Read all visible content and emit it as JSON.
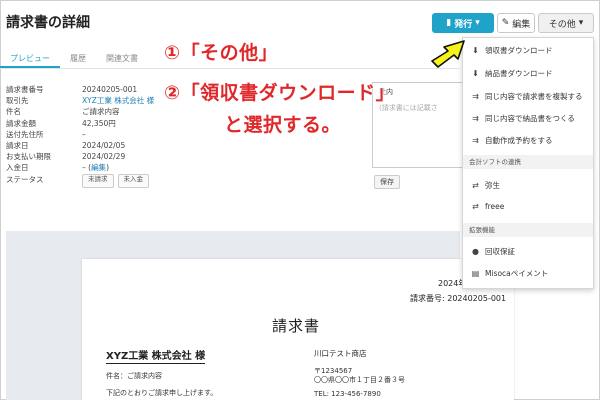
{
  "header": {
    "title": "請求書の詳細",
    "issue_label": "発行",
    "edit_label": "編集",
    "other_label": "その他"
  },
  "tabs": [
    {
      "label": "プレビュー",
      "active": true
    },
    {
      "label": "履歴",
      "active": false
    },
    {
      "label": "関連文書",
      "active": false
    }
  ],
  "info": {
    "rows": [
      {
        "label": "請求書番号",
        "value": "20240205-001"
      },
      {
        "label": "取引先",
        "value": "XYZ工業 株式会社 様"
      },
      {
        "label": "件名",
        "value": "ご請求内容"
      },
      {
        "label": "請求金額",
        "value": "42,350円"
      },
      {
        "label": "送付先住所",
        "value": "–"
      },
      {
        "label": "請求日",
        "value": "2024/02/05"
      },
      {
        "label": "お支払い期限",
        "value": "2024/02/29"
      },
      {
        "label": "入金日",
        "value": "– (",
        "link": "編集",
        "suffix": ")"
      },
      {
        "label": "ステータス",
        "value": ""
      }
    ],
    "status_buttons": [
      "未請求",
      "未入金"
    ]
  },
  "memo": {
    "label": "社内",
    "placeholder": "(請求書には記載さ",
    "save_label": "保存"
  },
  "document": {
    "date": "2024年0",
    "invoice_no": "請求番号: 20240205-001",
    "title": "請求書",
    "client": "XYZ工業 株式会社 様",
    "subject": "件名：ご請求内容",
    "note": "下記のとおりご請求申し上げます。",
    "company": "川口テスト商店",
    "postal": "〒1234567",
    "address": "〇〇県〇〇市１丁目２番３号",
    "tel": "TEL: 123-456-7890"
  },
  "dropdown": {
    "items": [
      {
        "label": "領収書ダウンロード",
        "icon": "download-icon",
        "glyph": "⬇"
      },
      {
        "label": "納品書ダウンロード",
        "icon": "download-icon",
        "glyph": "⬇"
      },
      {
        "label": "同じ内容で請求書を複製する",
        "icon": "duplicate-icon",
        "glyph": "⇉"
      },
      {
        "label": "同じ内容で納品書をつくる",
        "icon": "duplicate-icon",
        "glyph": "⇉"
      },
      {
        "label": "自動作成予約をする",
        "icon": "schedule-icon",
        "glyph": "⇉"
      }
    ],
    "section_accounting": "会計ソフトの連携",
    "accounting_items": [
      {
        "label": "弥生",
        "icon": "yayoi-icon",
        "glyph": "⇄"
      },
      {
        "label": "freee",
        "icon": "freee-icon",
        "glyph": "⇄"
      }
    ],
    "section_extension": "拡張機能",
    "extension_items": [
      {
        "label": "回収保証",
        "icon": "shield-icon",
        "glyph": "●"
      },
      {
        "label": "Misocaペイメント",
        "icon": "payment-icon",
        "glyph": "▤"
      }
    ]
  },
  "annotations": {
    "line1": "①「その他」",
    "line2": "②「領収書ダウンロード」",
    "line3": "と選択する。"
  },
  "colors": {
    "accent": "#1fa3c8",
    "annotation_red": "#e0282a",
    "arrow_yellow": "#f7f21a"
  }
}
